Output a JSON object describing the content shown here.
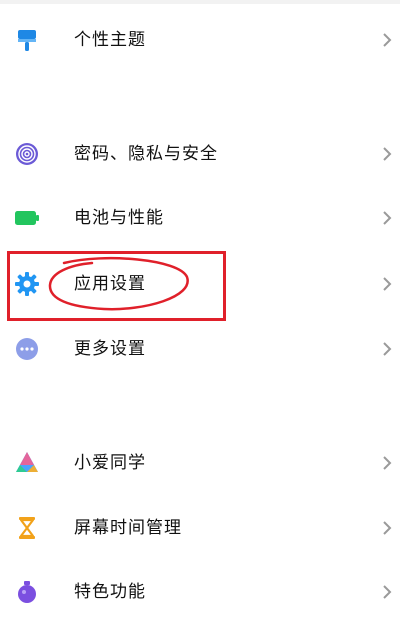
{
  "settings": {
    "items": [
      {
        "label": "个性主题",
        "icon": "theme-brush-icon",
        "color": "#1e88e5"
      },
      {
        "label": "密码、隐私与安全",
        "icon": "fingerprint-icon",
        "color": "#6b5ad6"
      },
      {
        "label": "电池与性能",
        "icon": "battery-icon",
        "color": "#22c55e"
      },
      {
        "label": "应用设置",
        "icon": "gear-icon",
        "color": "#2196f3"
      },
      {
        "label": "更多设置",
        "icon": "more-dots-icon",
        "color": "#8d9ee8"
      },
      {
        "label": "小爱同学",
        "icon": "xiaoai-assistant-icon",
        "color": "#4aa3ff"
      },
      {
        "label": "屏幕时间管理",
        "icon": "hourglass-icon",
        "color": "#f2a21a"
      },
      {
        "label": "特色功能",
        "icon": "potion-flask-icon",
        "color": "#7b4fe0"
      }
    ]
  },
  "annotation": {
    "color": "#e0202a"
  }
}
